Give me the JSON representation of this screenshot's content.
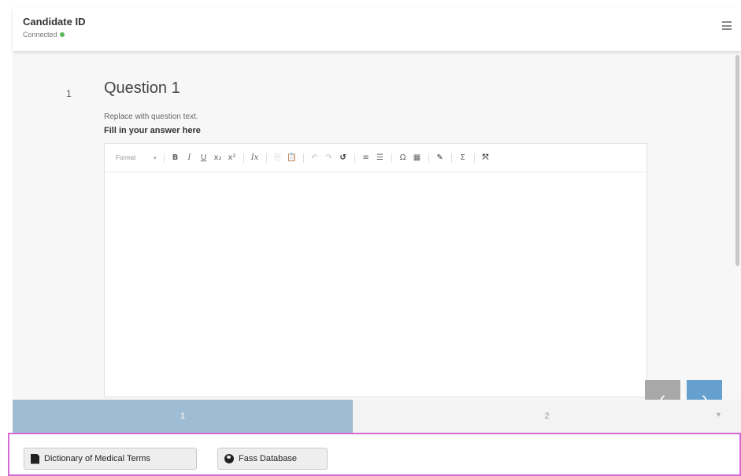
{
  "header": {
    "title": "Candidate ID",
    "status": "Connected",
    "status_color": "#5cb85c"
  },
  "question": {
    "number": "1",
    "title": "Question 1",
    "text": "Replace with question text.",
    "fill_label": "Fill in your answer here"
  },
  "editor": {
    "format_label": "Format",
    "format_caret": "▾",
    "buttons": [
      {
        "name": "bold",
        "glyph": "B"
      },
      {
        "name": "italic",
        "glyph": "I"
      },
      {
        "name": "underline",
        "glyph": "U"
      },
      {
        "name": "subscript",
        "glyph": "x₂"
      },
      {
        "name": "superscript",
        "glyph": "x²"
      },
      {
        "name": "remove-format",
        "glyph": "Ix"
      },
      {
        "name": "copy",
        "glyph": "⎘"
      },
      {
        "name": "paste",
        "glyph": "📋"
      },
      {
        "name": "undo",
        "glyph": "↶"
      },
      {
        "name": "redo",
        "glyph": "↷"
      },
      {
        "name": "spellcheck",
        "glyph": "↺"
      },
      {
        "name": "numbered-list",
        "glyph": "≡"
      },
      {
        "name": "bulleted-list",
        "glyph": "☰"
      },
      {
        "name": "special-char",
        "glyph": "Ω"
      },
      {
        "name": "table",
        "glyph": "▦"
      },
      {
        "name": "pen",
        "glyph": "✎"
      },
      {
        "name": "sigma",
        "glyph": "Σ"
      },
      {
        "name": "fullscreen",
        "glyph": "⤧"
      }
    ],
    "content": ""
  },
  "nav": {
    "prev_glyph": "‹",
    "next_glyph": "›",
    "prev_color": "#a8a8a8",
    "next_color": "#66a0cf"
  },
  "tabs": [
    {
      "label": "1",
      "active": true
    },
    {
      "label": "2",
      "active": false
    }
  ],
  "tabs_chevron": "▾",
  "resources": [
    {
      "label": "Dictionary of Medical Terms",
      "icon": "document-icon"
    },
    {
      "label": "Fass Database",
      "icon": "globe-icon"
    }
  ],
  "accent_color": "#9ebcd4",
  "highlight_border_color": "#d86ad8"
}
